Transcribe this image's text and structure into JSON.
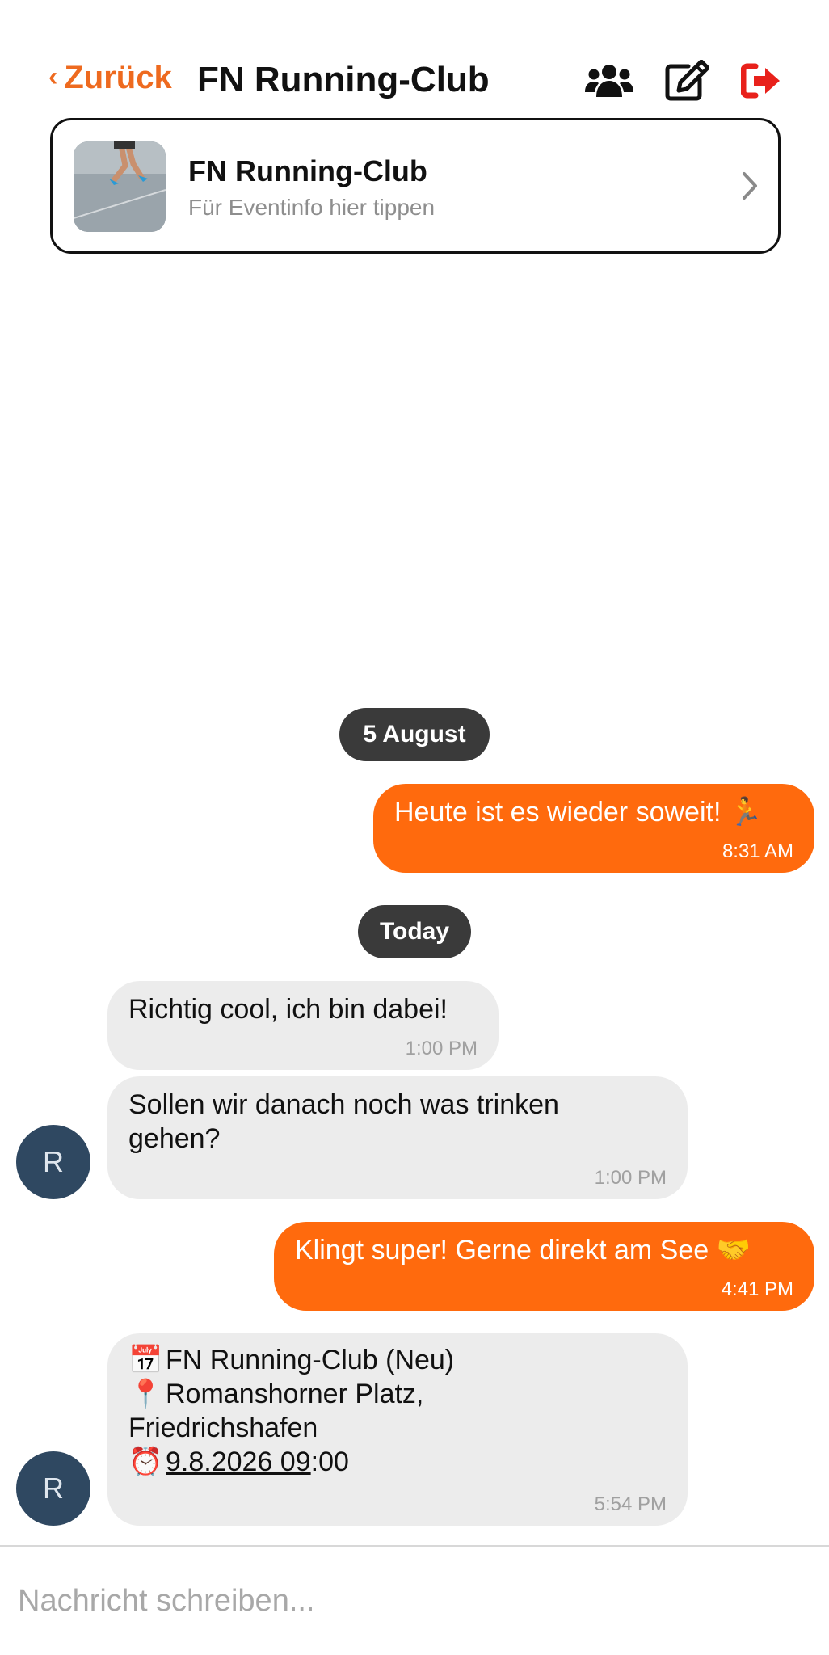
{
  "header": {
    "back_label": "Zurück",
    "title": "FN Running-Club",
    "accent_color": "#ee6a1f",
    "icons": [
      "users-icon",
      "edit-icon",
      "leave-icon"
    ]
  },
  "event_card": {
    "title": "FN Running-Club",
    "subtitle": "Für Eventinfo hier tippen"
  },
  "messages": {
    "date1": "5 August",
    "m1": {
      "text": "Heute ist es wieder soweit! 🏃",
      "time": "8:31 AM"
    },
    "date2": "Today",
    "m2": {
      "text": "Richtig cool, ich bin dabei!",
      "time": "1:00 PM"
    },
    "m3": {
      "line1": "Sollen wir danach noch was trinken",
      "line2": "gehen?",
      "time": "1:00 PM"
    },
    "m4": {
      "text": "Klingt super! Gerne direkt am See 🤝",
      "time": "4:41 PM"
    },
    "m5": {
      "line1_icon": "📅",
      "line1": "FN Running-Club (Neu)",
      "line2_icon": "📍",
      "line2": "Romanshorner Platz,",
      "line3": "Friedrichshafen",
      "line4_icon": "⏰",
      "line4_link": "9.8.2026 09",
      "line4_rest": ":00",
      "time": "5:54 PM"
    },
    "avatar_letter": "R"
  },
  "composer": {
    "placeholder": "Nachricht schreiben..."
  },
  "colors": {
    "outgoing": "#ff6a0d",
    "incoming": "#ececec",
    "pill": "#3a3a3a",
    "avatar": "#2f4861",
    "leave": "#e8211b"
  }
}
